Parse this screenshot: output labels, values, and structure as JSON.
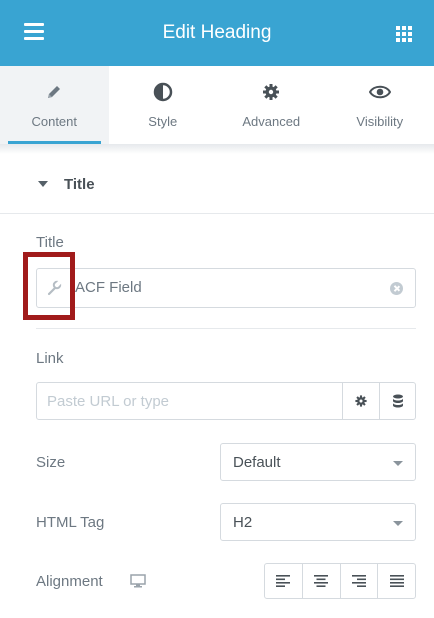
{
  "header": {
    "title": "Edit Heading",
    "menu_icon": "hamburger-menu-icon",
    "grid_icon": "widgets-grid-icon",
    "background": "#39a4d2"
  },
  "tabs": [
    {
      "label": "Content",
      "icon": "pencil-icon",
      "active": true
    },
    {
      "label": "Style",
      "icon": "half-circle-icon",
      "active": false
    },
    {
      "label": "Advanced",
      "icon": "gear-icon",
      "active": false
    },
    {
      "label": "Visibility",
      "icon": "eye-icon",
      "active": false
    }
  ],
  "section": {
    "title": "Title",
    "caret_icon": "caret-down-icon"
  },
  "fields": {
    "title": {
      "label": "Title",
      "value": "ACF Field",
      "dynamic_icon": "wrench-icon",
      "clear_icon": "clear-circle-icon"
    },
    "link": {
      "label": "Link",
      "placeholder": "Paste URL or type",
      "value": "",
      "settings_icon": "gear-icon",
      "dynamic_icon": "database-icon"
    },
    "size": {
      "label": "Size",
      "value": "Default"
    },
    "html_tag": {
      "label": "HTML Tag",
      "value": "H2"
    },
    "alignment": {
      "label": "Alignment",
      "device_icon": "desktop-icon",
      "options": [
        "align-left-icon",
        "align-center-icon",
        "align-right-icon",
        "align-justify-icon"
      ]
    }
  },
  "colors": {
    "accent": "#39a4d2",
    "highlight": "#a11b1b"
  }
}
